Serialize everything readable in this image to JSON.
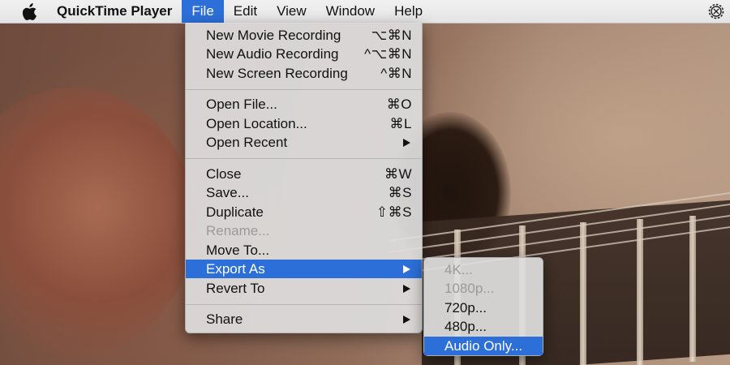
{
  "menubar": {
    "apple_icon": "apple-icon",
    "app_name": "QuickTime Player",
    "menus": [
      "File",
      "Edit",
      "View",
      "Window",
      "Help"
    ],
    "active_menu": "File",
    "right_icon": "gear-cog-icon"
  },
  "file_menu": {
    "groups": [
      [
        {
          "label": "New Movie Recording",
          "shortcut": "⌥⌘N"
        },
        {
          "label": "New Audio Recording",
          "shortcut": "^⌥⌘N"
        },
        {
          "label": "New Screen Recording",
          "shortcut": "^⌘N"
        }
      ],
      [
        {
          "label": "Open File...",
          "shortcut": "⌘O"
        },
        {
          "label": "Open Location...",
          "shortcut": "⌘L"
        },
        {
          "label": "Open Recent",
          "submenu": true
        }
      ],
      [
        {
          "label": "Close",
          "shortcut": "⌘W"
        },
        {
          "label": "Save...",
          "shortcut": "⌘S"
        },
        {
          "label": "Duplicate",
          "shortcut": "⇧⌘S"
        },
        {
          "label": "Rename...",
          "disabled": true
        },
        {
          "label": "Move To..."
        },
        {
          "label": "Export As",
          "submenu": true,
          "highlighted": true
        },
        {
          "label": "Revert To",
          "submenu": true
        }
      ],
      [
        {
          "label": "Share",
          "submenu": true
        }
      ]
    ]
  },
  "export_submenu": {
    "items": [
      {
        "label": "4K...",
        "disabled": true
      },
      {
        "label": "1080p...",
        "disabled": true
      },
      {
        "label": "720p..."
      },
      {
        "label": "480p..."
      },
      {
        "label": "Audio Only...",
        "highlighted": true
      }
    ]
  },
  "colors": {
    "highlight": "#2c6fd8",
    "menu_bg": "#dedede",
    "disabled_text": "#9a9a9a"
  }
}
